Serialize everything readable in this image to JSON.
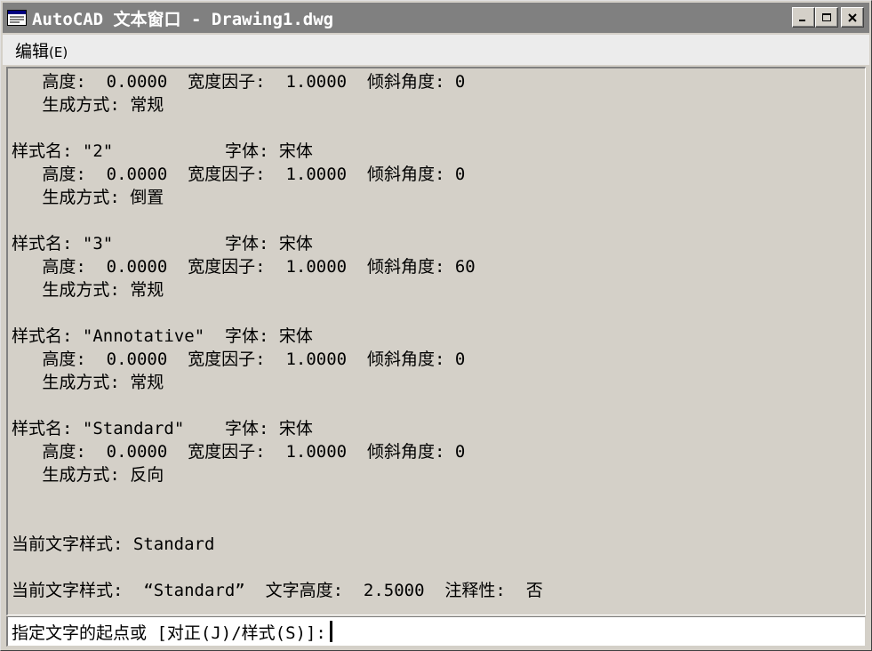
{
  "window": {
    "title": "AutoCAD 文本窗口 - Drawing1.dwg",
    "icon": "autocad-text-window-icon",
    "buttons": {
      "minimize": "minimize-icon",
      "maximize": "maximize-icon",
      "close": "close-icon"
    }
  },
  "menubar": {
    "items": [
      {
        "label": "编辑",
        "accelerator": "(E)"
      }
    ]
  },
  "history": {
    "lines": [
      "   高度:  0.0000  宽度因子:  1.0000  倾斜角度: 0",
      "   生成方式: 常规",
      "",
      "样式名: \"2\"           字体: 宋体",
      "   高度:  0.0000  宽度因子:  1.0000  倾斜角度: 0",
      "   生成方式: 倒置",
      "",
      "样式名: \"3\"           字体: 宋体",
      "   高度:  0.0000  宽度因子:  1.0000  倾斜角度: 60",
      "   生成方式: 常规",
      "",
      "样式名: \"Annotative\"  字体: 宋体",
      "   高度:  0.0000  宽度因子:  1.0000  倾斜角度: 0",
      "   生成方式: 常规",
      "",
      "样式名: \"Standard\"    字体: 宋体",
      "   高度:  0.0000  宽度因子:  1.0000  倾斜角度: 0",
      "   生成方式: 反向",
      "",
      "",
      "当前文字样式: Standard",
      "",
      "当前文字样式:  “Standard”  文字高度:  2.5000  注释性:  否"
    ]
  },
  "command": {
    "prompt": "指定文字的起点或 [对正(J)/样式(S)]:"
  },
  "colors": {
    "titlebar": "#808080",
    "window_face": "#d4d0c8",
    "menubar": "#ececec",
    "command_bg": "#ffffff"
  }
}
